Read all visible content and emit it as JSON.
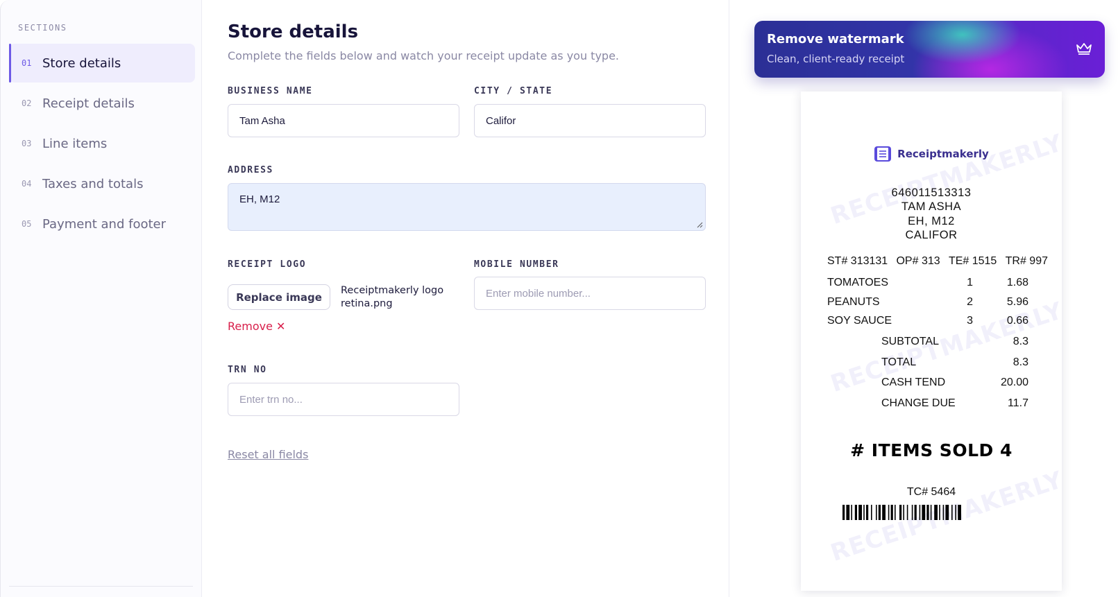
{
  "sidebar": {
    "heading": "SECTIONS",
    "items": [
      {
        "num": "01",
        "label": "Store details"
      },
      {
        "num": "02",
        "label": "Receipt details"
      },
      {
        "num": "03",
        "label": "Line items"
      },
      {
        "num": "04",
        "label": "Taxes and totals"
      },
      {
        "num": "05",
        "label": "Payment and footer"
      }
    ]
  },
  "form": {
    "title": "Store details",
    "subtitle": "Complete the fields below and watch your receipt update as you type.",
    "business_name": {
      "label": "BUSINESS NAME",
      "value": "Tam Asha"
    },
    "city_state": {
      "label": "CITY / STATE",
      "value": "Califor"
    },
    "address": {
      "label": "ADDRESS",
      "value": "EH, M12"
    },
    "logo": {
      "label": "RECEIPT LOGO",
      "replace_label": "Replace image",
      "file_line1": "Receiptmakerly logo",
      "file_line2": "retina.png",
      "remove_label": "Remove ✕"
    },
    "mobile": {
      "label": "MOBILE NUMBER",
      "placeholder": "Enter mobile number..."
    },
    "trn": {
      "label": "TRN NO",
      "placeholder": "Enter trn no..."
    },
    "reset_label": "Reset all fields"
  },
  "banner": {
    "title": "Remove watermark",
    "subtitle": "Clean, client-ready receipt"
  },
  "receipt": {
    "brand": "Receiptmakerly",
    "watermark": "RECEIPTMAKERLY",
    "phone": "646011513313",
    "name": "TAM ASHA",
    "address": "EH, M12",
    "city": "CALIFOR",
    "ids": [
      "ST# 313131",
      "OP# 313",
      "TE# 1515",
      "TR# 997"
    ],
    "items": [
      {
        "name": "TOMATOES",
        "qty": "1",
        "price": "1.68"
      },
      {
        "name": "PEANUTS",
        "qty": "2",
        "price": "5.96"
      },
      {
        "name": "SOY SAUCE",
        "qty": "3",
        "price": "0.66"
      }
    ],
    "totals": [
      {
        "label": "SUBTOTAL",
        "value": "8.3"
      },
      {
        "label": "TOTAL",
        "value": "8.3"
      },
      {
        "label": "CASH TEND",
        "value": "20.00"
      },
      {
        "label": "CHANGE DUE",
        "value": "11.7"
      }
    ],
    "items_sold": "# ITEMS SOLD 4",
    "tc": "TC# 5464"
  },
  "colors": {
    "accent": "#6d5ae6",
    "danger": "#d81e4a",
    "address_bg": "#e8effd"
  }
}
